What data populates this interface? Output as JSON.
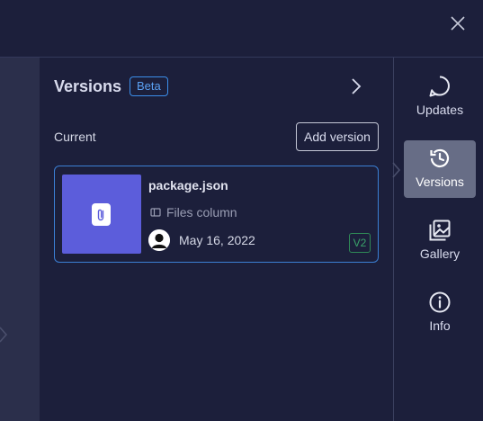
{
  "panel": {
    "title": "Versions",
    "badge": "Beta",
    "current_label": "Current",
    "add_version_label": "Add version"
  },
  "version_card": {
    "file_name": "package.json",
    "column": "Files column",
    "date": "May 16, 2022",
    "version_tag": "V2",
    "thumb_color": "#5c5ddb"
  },
  "rail": {
    "items": [
      {
        "label": "Updates",
        "icon": "chat-bubble-icon",
        "active": false
      },
      {
        "label": "Versions",
        "icon": "history-clock-icon",
        "active": true
      },
      {
        "label": "Gallery",
        "icon": "gallery-icon",
        "active": false
      },
      {
        "label": "Info",
        "icon": "info-icon",
        "active": false
      }
    ]
  },
  "colors": {
    "background": "#1c1f3b",
    "accent_blue": "#3b8eea",
    "active_rail": "#676d86",
    "version_green": "#3aa36a"
  }
}
